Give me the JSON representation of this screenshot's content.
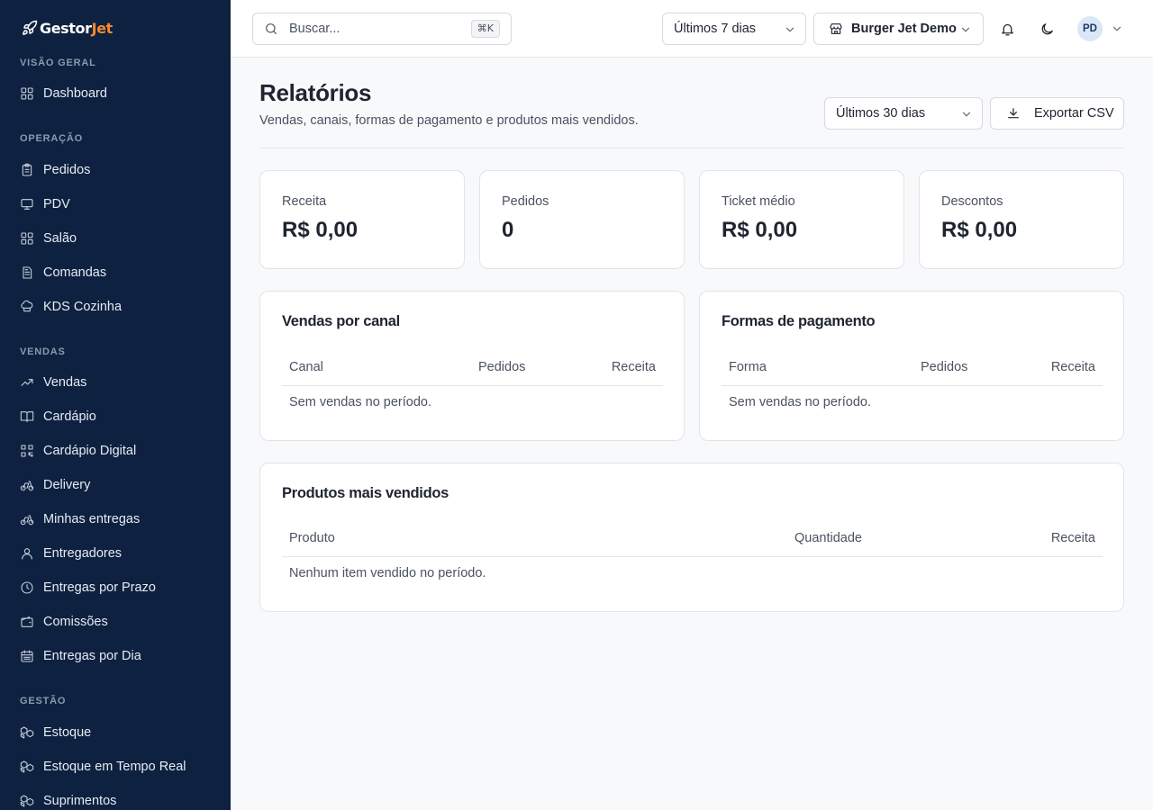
{
  "brand": {
    "name_part1": "Gestor",
    "name_part2": "Jet",
    "accent_color": "#f28a2e",
    "sidebar_bg": "#0e2140"
  },
  "sidebar": {
    "sections": [
      {
        "label": "VISÃO GERAL",
        "items": [
          {
            "label": "Dashboard",
            "icon": "grid-icon"
          }
        ]
      },
      {
        "label": "OPERAÇÃO",
        "items": [
          {
            "label": "Pedidos",
            "icon": "clipboard-icon"
          },
          {
            "label": "PDV",
            "icon": "monitor-icon"
          },
          {
            "label": "Salão",
            "icon": "grid-icon"
          },
          {
            "label": "Comandas",
            "icon": "document-icon"
          },
          {
            "label": "KDS Cozinha",
            "icon": "chef-hat-icon"
          }
        ]
      },
      {
        "label": "VENDAS",
        "items": [
          {
            "label": "Vendas",
            "icon": "trending-up-icon"
          },
          {
            "label": "Cardápio",
            "icon": "book-icon"
          },
          {
            "label": "Cardápio Digital",
            "icon": "qr-code-icon"
          },
          {
            "label": "Delivery",
            "icon": "bike-icon"
          },
          {
            "label": "Minhas entregas",
            "icon": "bike-icon"
          },
          {
            "label": "Entregadores",
            "icon": "user-icon"
          },
          {
            "label": "Entregas por Prazo",
            "icon": "clock-icon"
          },
          {
            "label": "Comissões",
            "icon": "wallet-icon"
          },
          {
            "label": "Entregas por Dia",
            "icon": "calendar-icon"
          }
        ]
      },
      {
        "label": "GESTÃO",
        "items": [
          {
            "label": "Estoque",
            "icon": "boxes-icon"
          },
          {
            "label": "Estoque em Tempo Real",
            "icon": "boxes-icon"
          },
          {
            "label": "Suprimentos",
            "icon": "boxes-icon"
          }
        ]
      }
    ]
  },
  "topbar": {
    "search_placeholder": "Buscar...",
    "search_shortcut": "⌘K",
    "period_select": "Últimos 7 dias",
    "store_select": "Burger Jet Demo",
    "avatar_initials": "PD"
  },
  "page": {
    "title": "Relatórios",
    "subtitle": "Vendas, canais, formas de pagamento e produtos mais vendidos.",
    "period_select": "Últimos 30 dias",
    "export_label": "Exportar CSV"
  },
  "stats": [
    {
      "label": "Receita",
      "value": "R$ 0,00"
    },
    {
      "label": "Pedidos",
      "value": "0"
    },
    {
      "label": "Ticket médio",
      "value": "R$ 0,00"
    },
    {
      "label": "Descontos",
      "value": "R$ 0,00"
    }
  ],
  "channels": {
    "title": "Vendas por canal",
    "columns": [
      "Canal",
      "Pedidos",
      "Receita"
    ],
    "empty": "Sem vendas no período."
  },
  "payments": {
    "title": "Formas de pagamento",
    "columns": [
      "Forma",
      "Pedidos",
      "Receita"
    ],
    "empty": "Sem vendas no período."
  },
  "products": {
    "title": "Produtos mais vendidos",
    "columns": [
      "Produto",
      "Quantidade",
      "Receita"
    ],
    "empty": "Nenhum item vendido no período."
  }
}
